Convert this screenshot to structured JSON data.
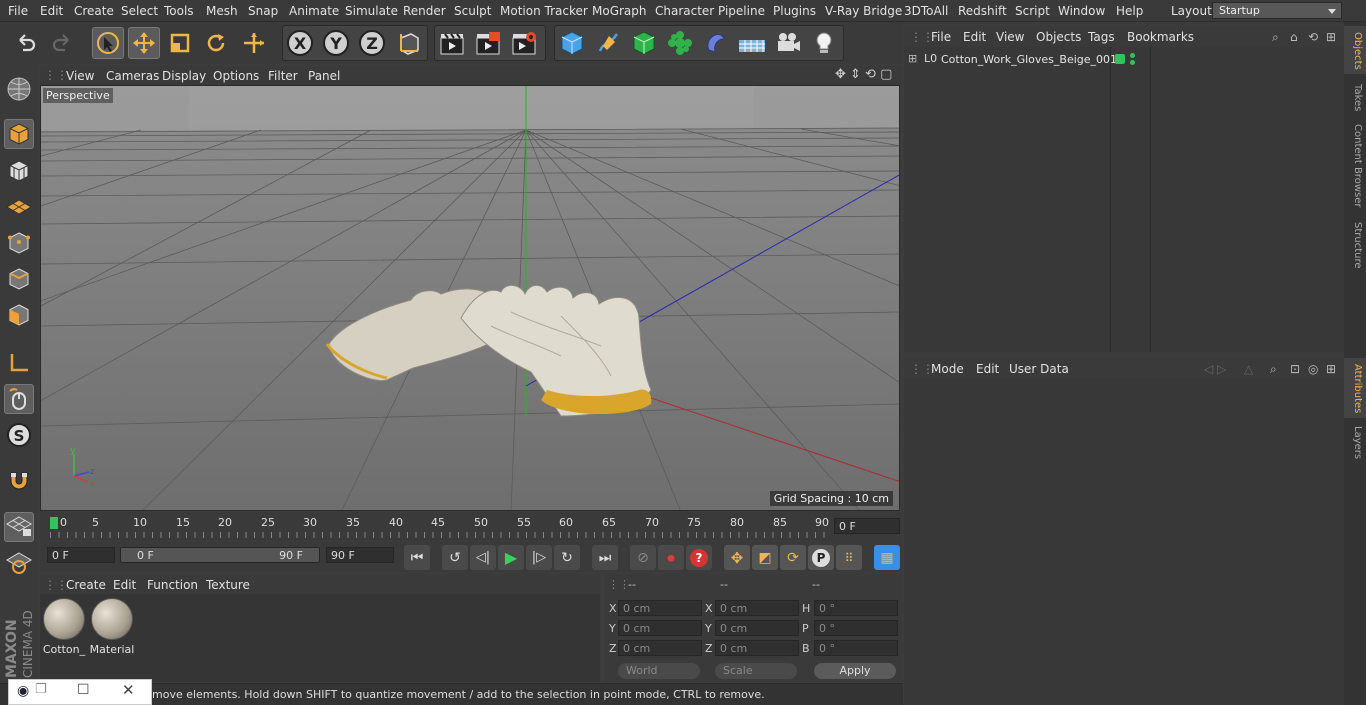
{
  "menu": [
    "File",
    "Edit",
    "Create",
    "Select",
    "Tools",
    "Mesh",
    "Snap",
    "Animate",
    "Simulate",
    "Render",
    "Sculpt",
    "Motion Tracker",
    "MoGraph",
    "Character",
    "Pipeline",
    "Plugins",
    "V-Ray Bridge",
    "3DToAll",
    "Redshift",
    "Script",
    "Window",
    "Help"
  ],
  "layout": {
    "label": "Layout:",
    "value": "Startup"
  },
  "viewport": {
    "menu": [
      "View",
      "Cameras",
      "Display",
      "Options",
      "Filter",
      "Panel"
    ],
    "camera_label": "Perspective",
    "grid_spacing": "Grid Spacing : 10 cm"
  },
  "timeline": {
    "ticks": [
      "0",
      "5",
      "10",
      "15",
      "20",
      "25",
      "30",
      "35",
      "40",
      "45",
      "50",
      "55",
      "60",
      "65",
      "70",
      "75",
      "80",
      "85",
      "90"
    ],
    "current_frame": "0 F",
    "start_field": "0 F",
    "range_start": "0 F",
    "range_end": "90 F",
    "end_field": "90 F"
  },
  "materials": {
    "menu": [
      "Create",
      "Edit",
      "Function",
      "Texture"
    ],
    "items": [
      "Cotton_",
      "Material"
    ]
  },
  "coords": {
    "headers": [
      "--",
      "--",
      "--"
    ],
    "rows": [
      {
        "a": "X",
        "av": "0 cm",
        "b": "X",
        "bv": "0 cm",
        "c": "H",
        "cv": "0 °"
      },
      {
        "a": "Y",
        "av": "0 cm",
        "b": "Y",
        "bv": "0 cm",
        "c": "P",
        "cv": "0 °"
      },
      {
        "a": "Z",
        "av": "0 cm",
        "b": "Z",
        "bv": "0 cm",
        "c": "B",
        "cv": "0 °"
      }
    ],
    "world": "World",
    "scale": "Scale",
    "apply": "Apply"
  },
  "objects": {
    "menu": [
      "File",
      "Edit",
      "View",
      "Objects",
      "Tags",
      "Bookmarks"
    ],
    "items": [
      {
        "name": "Cotton_Work_Gloves_Beige_001"
      }
    ]
  },
  "attributes": {
    "menu": [
      "Mode",
      "Edit",
      "User Data"
    ]
  },
  "side_tabs": [
    "Objects",
    "Takes",
    "Content Browser",
    "Structure",
    "Attributes",
    "Layers"
  ],
  "status": "move elements. Hold down SHIFT to quantize movement / add to the selection in point mode, CTRL to remove.",
  "brand": {
    "maxon": "MAXON",
    "product": "CINEMA 4D"
  },
  "colors": {
    "accent": "#f0b64b",
    "x_axis": "#c03030",
    "y_axis": "#30b030",
    "z_axis": "#3030c0",
    "active_blue": "#3a8ee6"
  }
}
